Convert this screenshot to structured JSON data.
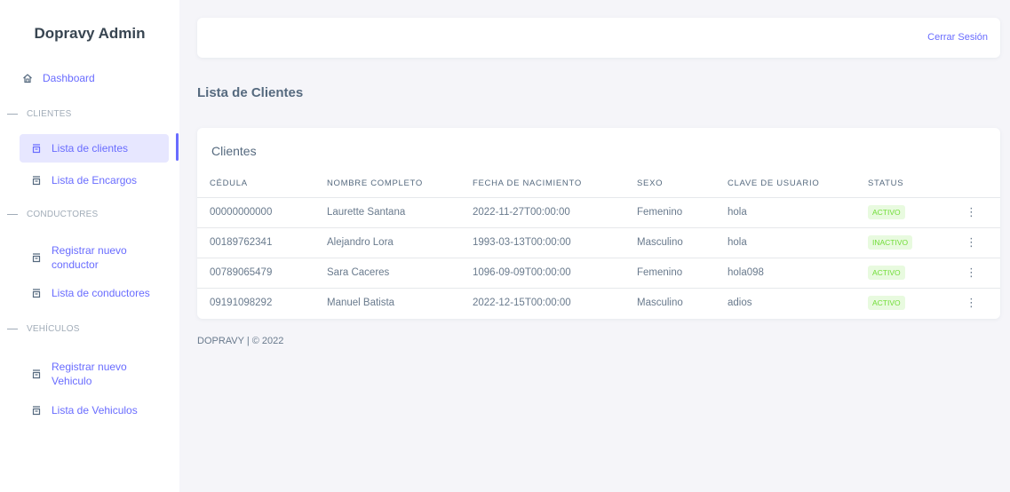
{
  "sidebar": {
    "brand": "Dopravy Admin",
    "dashboard_label": "Dashboard",
    "sections": {
      "clientes": "CLIENTES",
      "conductores": "CONDUCTORES",
      "vehiculos": "VEHÍCULOS"
    },
    "items": {
      "lista_clientes": "Lista de clientes",
      "lista_encargos": "Lista de Encargos",
      "registrar_conductor_line1": "Registrar nuevo",
      "registrar_conductor_line2": "conductor",
      "lista_conductores": "Lista de conductores",
      "registrar_vehiculo_line1": "Registrar nuevo",
      "registrar_vehiculo_line2": "Vehiculo",
      "lista_vehiculos": "Lista de Vehiculos"
    }
  },
  "navbar": {
    "logout": "Cerrar Sesión"
  },
  "page_title": "Lista de Clientes",
  "card": {
    "title": "Clientes",
    "columns": [
      "CÉDULA",
      "NOMBRE COMPLETO",
      "FECHA DE NACIMIENTO",
      "SEXO",
      "CLAVE DE USUARIO",
      "STATUS"
    ],
    "rows": [
      {
        "cedula": "00000000000",
        "nombre": "Laurette Santana",
        "fecha": "2022-11-27T00:00:00",
        "sexo": "Femenino",
        "clave": "hola",
        "status": "ACTIVO"
      },
      {
        "cedula": "00189762341",
        "nombre": "Alejandro Lora",
        "fecha": "1993-03-13T00:00:00",
        "sexo": "Masculino",
        "clave": "hola",
        "status": "INACTIVO"
      },
      {
        "cedula": "00789065479",
        "nombre": "Sara Caceres",
        "fecha": "1096-09-09T00:00:00",
        "sexo": "Femenino",
        "clave": "hola098",
        "status": "ACTIVO"
      },
      {
        "cedula": "09191098292",
        "nombre": "Manuel Batista",
        "fecha": "2022-12-15T00:00:00",
        "sexo": "Masculino",
        "clave": "adios",
        "status": "ACTIVO"
      }
    ],
    "row_menu_glyph": "⋮"
  },
  "footer": "DOPRAVY | © 2022",
  "colors": {
    "accent": "#696cff",
    "badge_bg": "#e8fadf",
    "badge_text": "#71dd37"
  },
  "icons": {
    "dashboard": "home-icon",
    "list": "box-icon"
  }
}
